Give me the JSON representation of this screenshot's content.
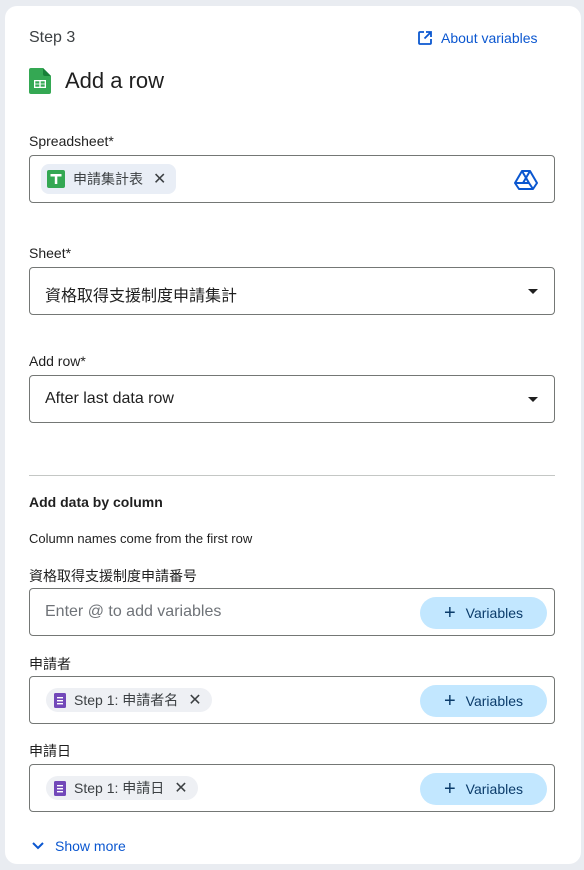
{
  "header": {
    "step_label": "Step 3",
    "about_link": "About variables",
    "title": "Add a row"
  },
  "spreadsheet": {
    "label": "Spreadsheet*",
    "chip_text": "申請集計表"
  },
  "sheet": {
    "label": "Sheet*",
    "value": "資格取得支援制度申請集計"
  },
  "add_row": {
    "label": "Add row*",
    "value": "After last data row"
  },
  "columns": {
    "section_title": "Add data by column",
    "hint": "Column names come from the first row",
    "items": [
      {
        "label": "資格取得支援制度申請番号",
        "placeholder": "Enter @ to add variables",
        "chip": ""
      },
      {
        "label": "申請者",
        "placeholder": "",
        "chip": "Step 1: 申請者名"
      },
      {
        "label": "申請日",
        "placeholder": "",
        "chip": "Step 1: 申請日"
      }
    ],
    "variables_label": "Variables"
  },
  "show_more": "Show more",
  "colors": {
    "accent": "#0b57d0",
    "variables_button": "#c2e7ff",
    "sheets_green": "#34a853",
    "forms_purple": "#7248b9"
  }
}
